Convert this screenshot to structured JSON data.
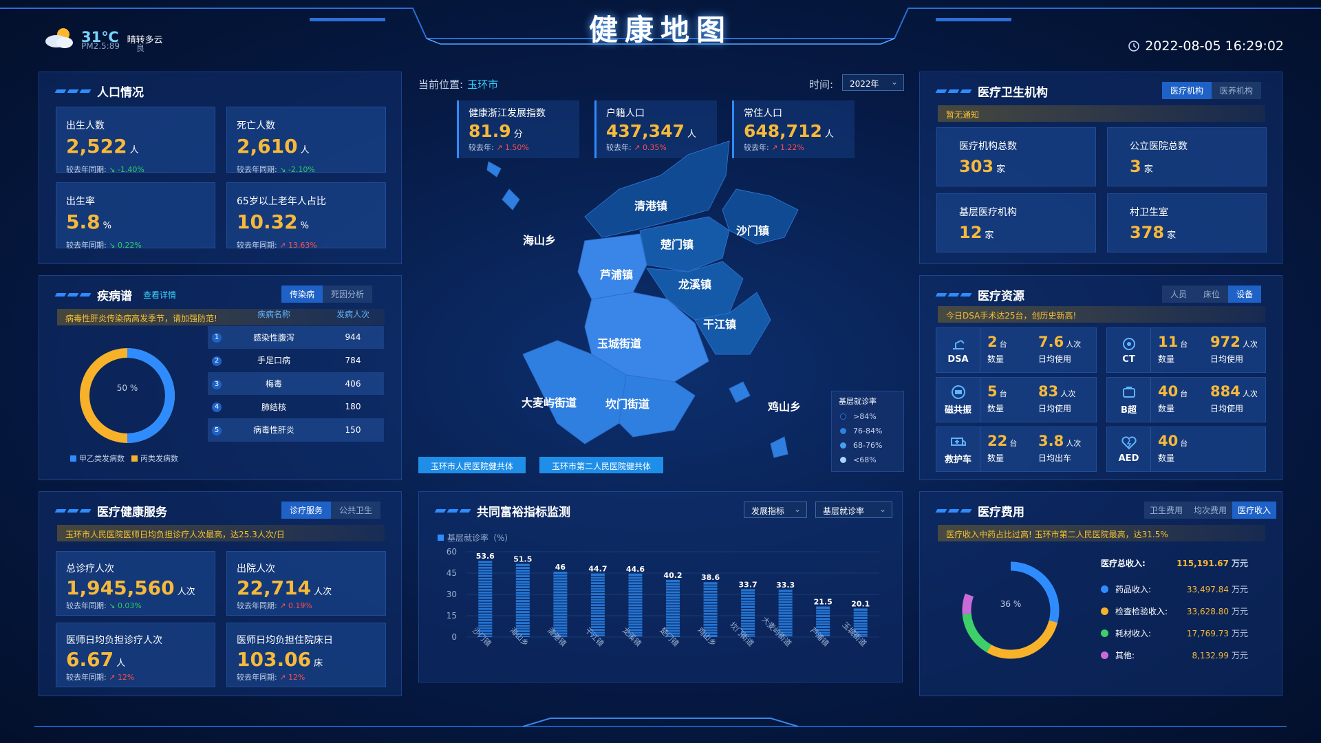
{
  "header": {
    "title": "健康地图",
    "temp": "31℃",
    "weather": "晴转多云",
    "pm": "PM2.5:89",
    "pm_quality": "良",
    "datetime": "2022-08-05 16:29:02"
  },
  "population": {
    "title": "人口情况",
    "cards": [
      {
        "label": "出生人数",
        "value": "2,522",
        "unit": "人",
        "cmp_label": "较去年同期:",
        "trend": "down",
        "change": "-1.40%"
      },
      {
        "label": "死亡人数",
        "value": "2,610",
        "unit": "人",
        "cmp_label": "较去年同期:",
        "trend": "down",
        "change": "-2.10%"
      },
      {
        "label": "出生率",
        "value": "5.8",
        "unit": "%",
        "cmp_label": "较去年同期:",
        "trend": "down",
        "change": "0.22%"
      },
      {
        "label": "65岁以上老年人占比",
        "value": "10.32",
        "unit": "%",
        "cmp_label": "较去年同期:",
        "trend": "up",
        "change": "13.63%"
      }
    ]
  },
  "disease": {
    "title": "疾病谱",
    "link": "查看详情",
    "tabs": [
      "传染病",
      "死因分析"
    ],
    "notice": "病毒性肝炎传染病高发季节，请加强防范!",
    "donut_label": "50 %",
    "donut_fraction": 0.5,
    "legend": [
      "甲乙类发病数",
      "丙类发病数"
    ],
    "columns": [
      "疾病名称",
      "发病人次"
    ],
    "rows": [
      {
        "rank": "1",
        "name": "感染性腹泻",
        "count": "944"
      },
      {
        "rank": "2",
        "name": "手足口病",
        "count": "784"
      },
      {
        "rank": "3",
        "name": "梅毒",
        "count": "406"
      },
      {
        "rank": "4",
        "name": "肺结核",
        "count": "180"
      },
      {
        "rank": "5",
        "name": "病毒性肝炎",
        "count": "150"
      }
    ]
  },
  "service": {
    "title": "医疗健康服务",
    "tabs": [
      "诊疗服务",
      "公共卫生"
    ],
    "notice": "玉环市人民医院医师日均负担诊疗人次最高，达25.3人次/日",
    "cards": [
      {
        "label": "总诊疗人次",
        "value": "1,945,560",
        "unit": "人次",
        "cmp_label": "较去年同期:",
        "trend": "down",
        "change": "0.03%"
      },
      {
        "label": "出院人次",
        "value": "22,714",
        "unit": "人次",
        "cmp_label": "较去年同期:",
        "trend": "up",
        "change": "0.19%"
      },
      {
        "label": "医师日均负担诊疗人次",
        "value": "6.67",
        "unit": "人",
        "cmp_label": "较去年同期:",
        "trend": "up",
        "change": "12%"
      },
      {
        "label": "医师日均负担住院床日",
        "value": "103.06",
        "unit": "床",
        "cmp_label": "较去年同期:",
        "trend": "up",
        "change": "12%"
      }
    ]
  },
  "center": {
    "location_label": "当前位置:",
    "location": "玉环市",
    "time_label": "时间:",
    "year": "2022年",
    "stats": [
      {
        "label": "健康浙江发展指数",
        "value": "81.9",
        "unit": "分",
        "cmp_label": "较去年:",
        "change": "1.50%"
      },
      {
        "label": "户籍人口",
        "value": "437,347",
        "unit": "人",
        "cmp_label": "较去年:",
        "change": "0.35%"
      },
      {
        "label": "常住人口",
        "value": "648,712",
        "unit": "人",
        "cmp_label": "较去年:",
        "change": "1.22%"
      }
    ],
    "regions": [
      "清港镇",
      "海山乡",
      "沙门镇",
      "楚门镇",
      "芦浦镇",
      "龙溪镇",
      "干江镇",
      "玉城街道",
      "大麦屿街道",
      "坎门街道",
      "鸡山乡"
    ],
    "chips": [
      "玉环市人民医院健共体",
      "玉环市第二人民医院健共体"
    ],
    "legend": {
      "title": "基层就诊率",
      "items": [
        ">84%",
        "76-84%",
        "68-76%",
        "<68%"
      ],
      "colors": [
        "#0a2a5e",
        "#2f7fe0",
        "#4a9cf0",
        "#a9d4ff"
      ]
    }
  },
  "prosperity": {
    "title": "共同富裕指标监测",
    "select1": "发展指标",
    "select2": "基层就诊率"
  },
  "chart_data": {
    "type": "bar",
    "series": [
      {
        "name": "基层就诊率（%）",
        "values": [
          53.6,
          51.5,
          46,
          44.7,
          44.6,
          40.2,
          38.6,
          33.7,
          33.3,
          21.5,
          20.1
        ]
      }
    ],
    "categories": [
      "沙门镇",
      "海山乡",
      "清港镇",
      "干江镇",
      "龙溪镇",
      "楚门镇",
      "鸡山乡",
      "坎门街道",
      "大麦屿街道",
      "芦浦镇",
      "玉城街道"
    ],
    "ylim": [
      0,
      60
    ],
    "yticks": [
      "60",
      "45",
      "30",
      "15",
      "0"
    ],
    "bar_labels": [
      "53.6",
      "51.5",
      "46",
      "44.7",
      "44.6",
      "40.2",
      "38.6",
      "33.7",
      "33.3",
      "21.5",
      "20.1"
    ]
  },
  "institution": {
    "title": "医疗卫生机构",
    "tabs": [
      "医疗机构",
      "医养机构"
    ],
    "notice": "暂无通知",
    "cards": [
      {
        "label": "医疗机构总数",
        "value": "303",
        "unit": "家"
      },
      {
        "label": "公立医院总数",
        "value": "3",
        "unit": "家"
      },
      {
        "label": "基层医疗机构",
        "value": "12",
        "unit": "家"
      },
      {
        "label": "村卫生室",
        "value": "378",
        "unit": "家"
      }
    ]
  },
  "resources": {
    "title": "医疗资源",
    "tabs": [
      "人员",
      "床位",
      "设备"
    ],
    "notice": "今日DSA手术达25台，创历史新高!",
    "items": [
      {
        "name": "DSA",
        "icon": "dsa-icon",
        "v1": "2",
        "u1": "台",
        "k1": "数量",
        "v2": "7.6",
        "u2": "人次",
        "k2": "日均使用"
      },
      {
        "name": "CT",
        "icon": "ct-icon",
        "v1": "11",
        "u1": "台",
        "k1": "数量",
        "v2": "972",
        "u2": "人次",
        "k2": "日均使用"
      },
      {
        "name": "磁共振",
        "icon": "mri-icon",
        "v1": "5",
        "u1": "台",
        "k1": "数量",
        "v2": "83",
        "u2": "人次",
        "k2": "日均使用"
      },
      {
        "name": "B超",
        "icon": "ultrasound-icon",
        "v1": "40",
        "u1": "台",
        "k1": "数量",
        "v2": "884",
        "u2": "人次",
        "k2": "日均使用"
      },
      {
        "name": "救护车",
        "icon": "ambulance-icon",
        "v1": "22",
        "u1": "台",
        "k1": "数量",
        "v2": "3.8",
        "u2": "人次",
        "k2": "日均出车"
      },
      {
        "name": "AED",
        "icon": "aed-icon",
        "v1": "40",
        "u1": "台",
        "k1": "数量",
        "v2": "",
        "u2": "",
        "k2": ""
      }
    ]
  },
  "fees": {
    "title": "医疗费用",
    "tabs": [
      "卫生费用",
      "均次费用",
      "医疗收入"
    ],
    "notice": "医疗收入中药占比过高! 玉环市第二人民医院最高，达31.5%",
    "donut_label": "36 %",
    "total_label": "医疗总收入:",
    "total": "115,191.67",
    "unit": "万元",
    "items": [
      {
        "label": "药品收入:",
        "value": "33,497.84",
        "color": "#2f8cff"
      },
      {
        "label": "检查检验收入:",
        "value": "33,628.80",
        "color": "#f7b22a"
      },
      {
        "label": "耗材收入:",
        "value": "17,769.73",
        "color": "#3fcf6a"
      },
      {
        "label": "其他:",
        "value": "8,132.99",
        "color": "#c86bd8"
      }
    ]
  }
}
